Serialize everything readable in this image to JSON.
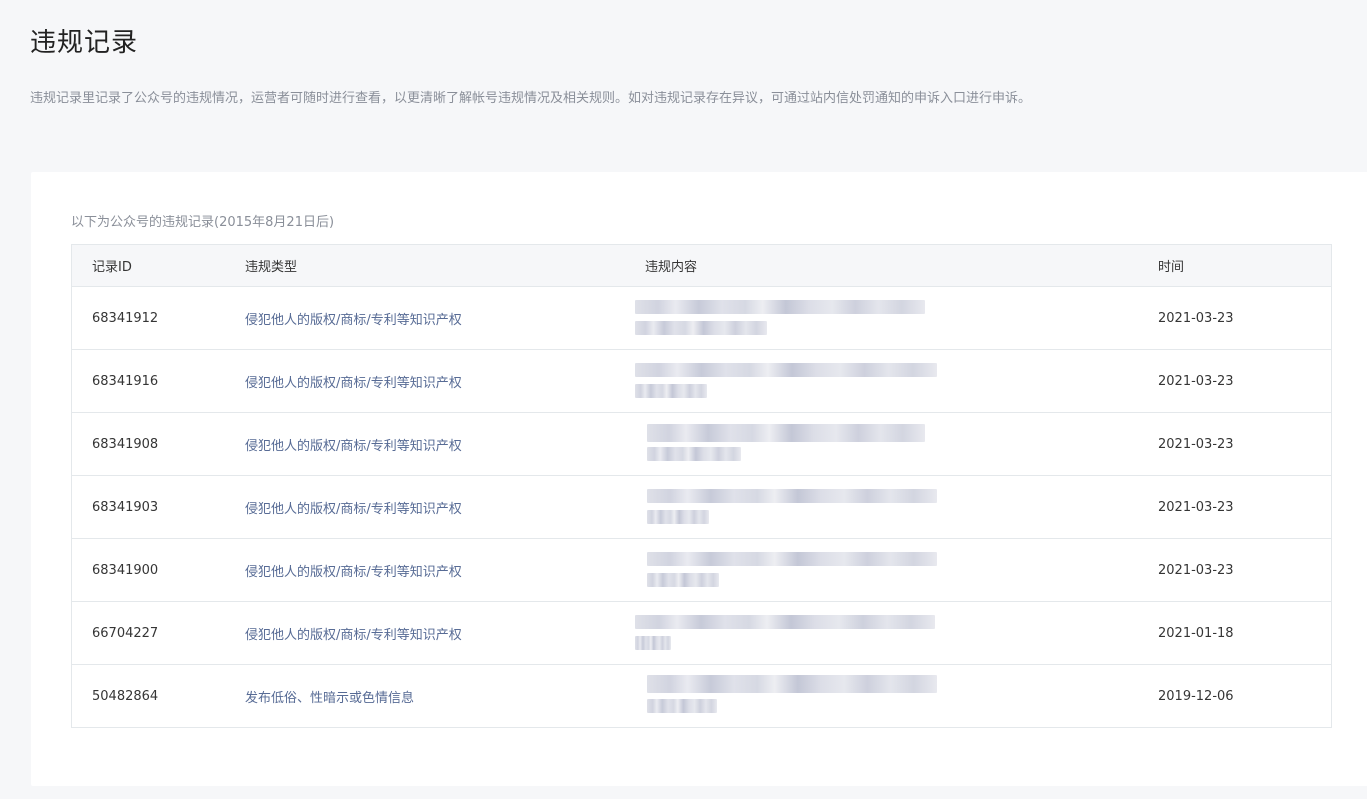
{
  "page": {
    "title": "违规记录",
    "description": "违规记录里记录了公众号的违规情况，运营者可随时进行查看，以更清晰了解帐号违规情况及相关规则。如对违规记录存在异议，可通过站内信处罚通知的申诉入口进行申诉。"
  },
  "records": {
    "caption": "以下为公众号的违规记录(2015年8月21日后)",
    "columns": {
      "id": "记录ID",
      "type": "违规类型",
      "content": "违规内容",
      "time": "时间"
    },
    "rows": [
      {
        "id": "68341912",
        "type": "侵犯他人的版权/商标/专利等知识产权",
        "time": "2021-03-23"
      },
      {
        "id": "68341916",
        "type": "侵犯他人的版权/商标/专利等知识产权",
        "time": "2021-03-23"
      },
      {
        "id": "68341908",
        "type": "侵犯他人的版权/商标/专利等知识产权",
        "time": "2021-03-23"
      },
      {
        "id": "68341903",
        "type": "侵犯他人的版权/商标/专利等知识产权",
        "time": "2021-03-23"
      },
      {
        "id": "68341900",
        "type": "侵犯他人的版权/商标/专利等知识产权",
        "time": "2021-03-23"
      },
      {
        "id": "66704227",
        "type": "侵犯他人的版权/商标/专利等知识产权",
        "time": "2021-01-18"
      },
      {
        "id": "50482864",
        "type": "发布低俗、性暗示或色情信息",
        "time": "2019-12-06"
      }
    ]
  }
}
